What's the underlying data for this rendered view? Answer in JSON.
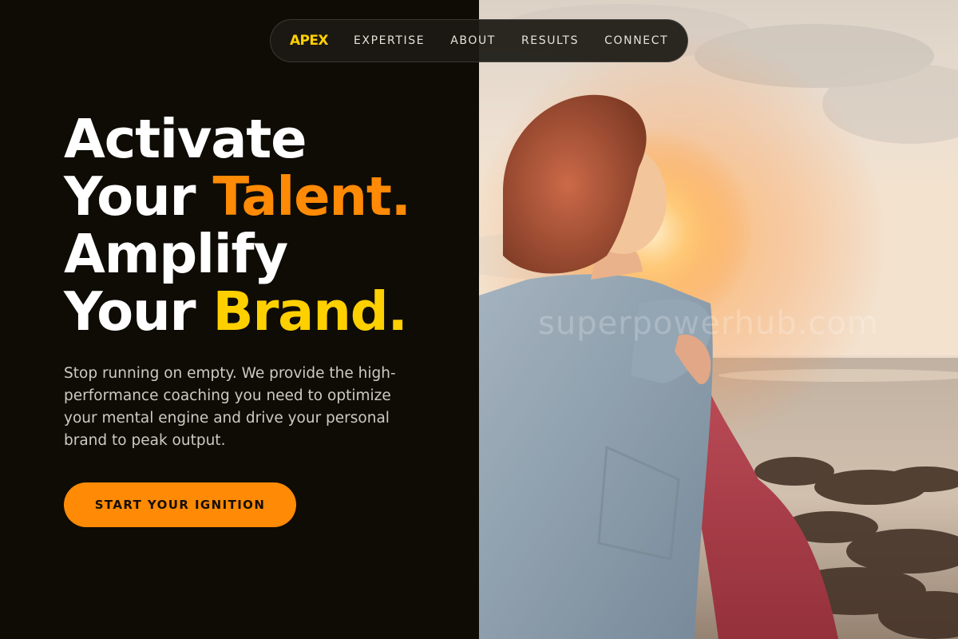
{
  "nav": {
    "logo": "APEX",
    "links": [
      "EXPERTISE",
      "ABOUT",
      "RESULTS",
      "CONNECT"
    ]
  },
  "hero": {
    "line1": "Activate",
    "line2_prefix": "Your ",
    "line2_accent": "Talent.",
    "line3": "Amplify",
    "line4_prefix": "Your ",
    "line4_accent": "Brand.",
    "description": "Stop running on empty. We provide the high-performance coaching you need to optimize your mental engine and drive your personal brand to peak output.",
    "cta_label": "START YOUR IGNITION"
  },
  "photo": {
    "alt": "Woman with arms outstretched facing the sunset by the sea",
    "watermark": "superpowerhub.com"
  },
  "colors": {
    "background": "#0f0c06",
    "accent_orange": "#ff8a05",
    "accent_yellow": "#ffd000",
    "text_white": "#ffffff",
    "text_muted": "#cfcac0"
  }
}
